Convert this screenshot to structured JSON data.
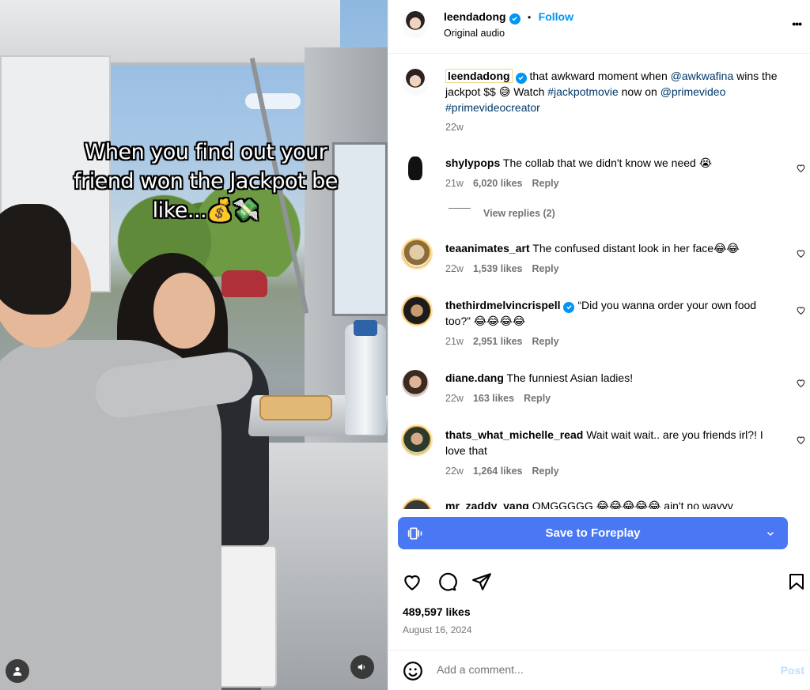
{
  "video": {
    "caption_line1": "When you find out your",
    "caption_line2": "friend won the Jackpot be",
    "caption_line3": "like...💰💸"
  },
  "header": {
    "username": "leendadong",
    "separator": "•",
    "follow_label": "Follow",
    "audio_label": "Original audio",
    "more_label": "•••"
  },
  "post": {
    "username": "leendadong",
    "caption_part1": "that awkward moment when ",
    "mention1": "@awkwafina",
    "caption_part2": " wins the jackpot $$ 😅 Watch ",
    "hashtag1": "#jackpotmovie",
    "caption_part3": " now on ",
    "mention2": "@primevideo",
    "hashtag2": "#primevideocreator",
    "age": "22w"
  },
  "comments": [
    {
      "username": "shylypops",
      "text": "The collab that we didn't know we need 😭",
      "age": "21w",
      "likes": "6,020 likes",
      "reply": "Reply",
      "view_replies": "View replies (2)"
    },
    {
      "username": "teaanimates_art",
      "text": "The confused distant look in her face😂😂",
      "age": "22w",
      "likes": "1,539 likes",
      "reply": "Reply"
    },
    {
      "username": "thethirdmelvincrispell",
      "text": "“Did you wanna order your own food too?” 😂😂😂😂",
      "age": "21w",
      "likes": "2,951 likes",
      "reply": "Reply"
    },
    {
      "username": "diane.dang",
      "text": "The funniest Asian ladies!",
      "age": "22w",
      "likes": "163 likes",
      "reply": "Reply"
    },
    {
      "username": "thats_what_michelle_read",
      "text": "Wait wait wait.. are you friends irl?! I love that",
      "age": "22w",
      "likes": "1,264 likes",
      "reply": "Reply"
    },
    {
      "username": "mr_zaddy_yang",
      "text": "OMGGGGG 😂😂😂😂😂 ain't no wayyy"
    }
  ],
  "cta": {
    "label": "Save to Foreplay"
  },
  "stats": {
    "likes": "489,597 likes",
    "date": "August 16, 2024"
  },
  "footer": {
    "placeholder": "Add a comment...",
    "post_label": "Post"
  },
  "colors": {
    "accent": "#0095f6",
    "cta": "#4a78f5",
    "link": "#00376b",
    "muted": "#737373"
  },
  "icons": [
    "heart-icon",
    "comment-icon",
    "share-icon",
    "bookmark-icon",
    "emoji-icon",
    "verified-icon",
    "more-icon",
    "user-tag-icon",
    "audio-icon",
    "foreplay-icon",
    "chevron-down-icon"
  ]
}
